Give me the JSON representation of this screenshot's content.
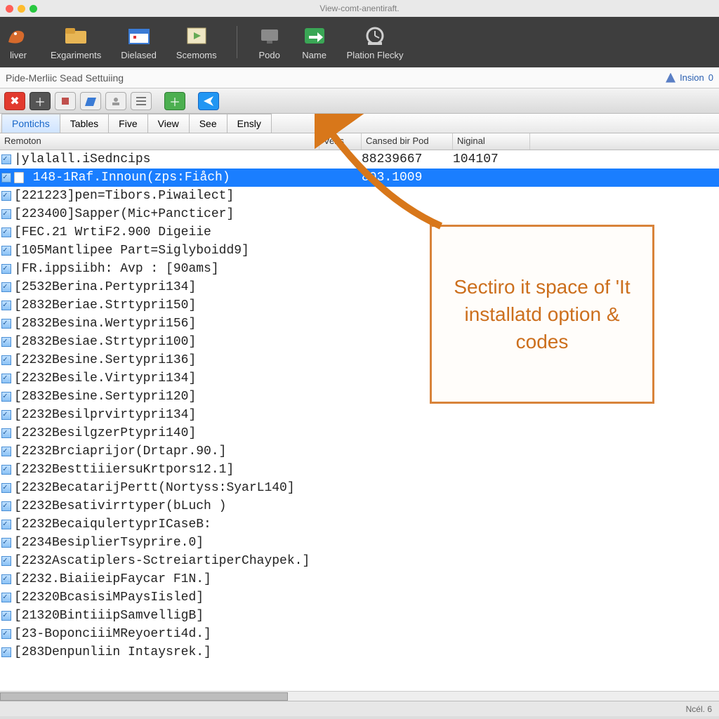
{
  "window": {
    "title": "View-comt-anentiraft."
  },
  "toolbar": [
    {
      "label": "liver",
      "icon": "dragon-icon",
      "color": "#d66a2c"
    },
    {
      "label": "Exgariments",
      "icon": "folder-icon",
      "color": "#e8b655"
    },
    {
      "label": "Dielased",
      "icon": "calendar-icon",
      "color": "#3a7bd5"
    },
    {
      "label": "Scemoms",
      "icon": "play-icon",
      "color": "#d8cfa0"
    },
    {
      "label": "Podo",
      "icon": "monitor-icon",
      "color": "#9e9e9e"
    },
    {
      "label": "Name",
      "icon": "arrow-icon",
      "color": "#3aa655"
    },
    {
      "label": "Plation Flecky",
      "icon": "clock-icon",
      "color": "#cfcfcf"
    }
  ],
  "subheader": {
    "title": "Pide-Merliic Sead Settuiing",
    "insion_label": "Insion",
    "insion_val": "0"
  },
  "tabs": [
    "Pontichs",
    "Tables",
    "Five",
    "View",
    "See",
    "Ensly"
  ],
  "active_tab": 0,
  "columns": [
    "Remoton",
    "Vens",
    "Cansed bir Pod",
    "Niginal"
  ],
  "rows": [
    {
      "t": "|ylalall.iSedncips",
      "v": "",
      "c": "88239667",
      "n": "104107",
      "sel": false,
      "icon": "blank"
    },
    {
      "t": " 148-1Raf.Innoun(zps:Fiåch)",
      "v": "",
      "c": "803.1009",
      "n": "",
      "sel": true,
      "icon": "file"
    },
    {
      "t": "[221223]pen=Tibors.Piwailect]",
      "v": "",
      "c": "",
      "n": "",
      "sel": false
    },
    {
      "t": "[223400]Sapper(Mic+Pancticer]",
      "v": "",
      "c": "",
      "n": "",
      "sel": false
    },
    {
      "t": "[FEC.21 WrtiF2.900 Digeiie",
      "v": "",
      "c": "",
      "n": "",
      "sel": false
    },
    {
      "t": "[105Mantlipee Part=Siglyboidd9]",
      "v": "",
      "c": "",
      "n": "",
      "sel": false
    },
    {
      "t": "|FR.ippsiibh: Avp : [90ams]",
      "v": "",
      "c": "",
      "n": "",
      "sel": false
    },
    {
      "t": "[2532Berina.Pertypri134]",
      "v": "",
      "c": "",
      "n": "",
      "sel": false
    },
    {
      "t": "[2832Beriae.Strtypri150]",
      "v": "",
      "c": "",
      "n": "",
      "sel": false
    },
    {
      "t": "[2832Besina.Wertypri156]",
      "v": "",
      "c": "",
      "n": "",
      "sel": false
    },
    {
      "t": "[2832Besiae.Strtypri100]",
      "v": "",
      "c": "",
      "n": "",
      "sel": false
    },
    {
      "t": "[2232Besine.Sertypri136]",
      "v": "",
      "c": "",
      "n": "",
      "sel": false
    },
    {
      "t": "[2232Besile.Virtypri134]",
      "v": "",
      "c": "",
      "n": "",
      "sel": false
    },
    {
      "t": "[2832Besine.Sertypri120]",
      "v": "",
      "c": "",
      "n": "",
      "sel": false
    },
    {
      "t": "[2232Besilprvirtypri134]",
      "v": "",
      "c": "",
      "n": "",
      "sel": false
    },
    {
      "t": "[2232BesilgzerPtypri140]",
      "v": "",
      "c": "",
      "n": "",
      "sel": false
    },
    {
      "t": "[2232Brciaprijor(Drtapr.90.]",
      "v": "",
      "c": "",
      "n": "",
      "sel": false
    },
    {
      "t": "[2232BesttiiiersuKrtpors12.1]",
      "v": "",
      "c": "",
      "n": "",
      "sel": false
    },
    {
      "t": "[2232BecatarijPertt(Nortyss:SyarL140]",
      "v": "",
      "c": "",
      "n": "",
      "sel": false
    },
    {
      "t": "[2232Besativirrtyper(bLuch )",
      "v": "",
      "c": "",
      "n": "",
      "sel": false
    },
    {
      "t": "[2232BecaiqulertyprICaseB:",
      "v": "",
      "c": "",
      "n": "",
      "sel": false
    },
    {
      "t": "[2234BesiplierTsyprire.0]",
      "v": "",
      "c": "",
      "n": "",
      "sel": false
    },
    {
      "t": "[2232Ascatiplers-SctreiartiperChaypek.]",
      "v": "",
      "c": "",
      "n": "",
      "sel": false
    },
    {
      "t": "[2232.BiaiieipFaycar F1N.]",
      "v": "",
      "c": "",
      "n": "",
      "sel": false
    },
    {
      "t": "[22320BcasisiMPaysIisled]",
      "v": "",
      "c": "",
      "n": "",
      "sel": false
    },
    {
      "t": "[21320BintiiipSamvelligB]",
      "v": "",
      "c": "",
      "n": "",
      "sel": false
    },
    {
      "t": "[23-BoponciiiMReyoerti4d.]",
      "v": "",
      "c": "",
      "n": "",
      "sel": false
    },
    {
      "t": "[283Denpunliin Intaysrek.]",
      "v": "",
      "c": "",
      "n": "",
      "sel": false
    }
  ],
  "callout": {
    "text": "Sectiro it space of 'It installatd option & codes"
  },
  "status": {
    "right1": "Ncél. 6"
  }
}
